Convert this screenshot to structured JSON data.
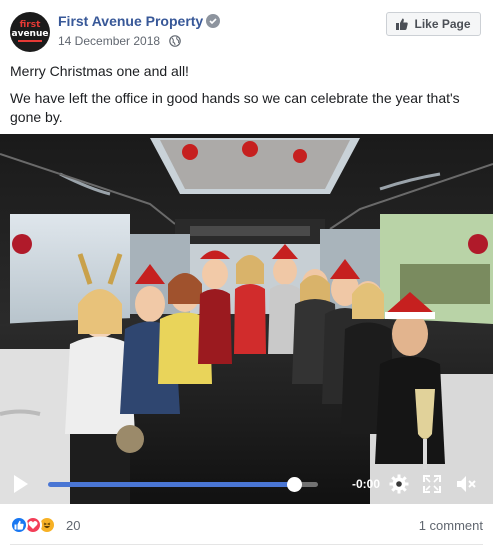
{
  "header": {
    "avatar_line1": "first",
    "avatar_line2": "avenue",
    "page_name": "First Avenue Property",
    "date": "14 December 2018",
    "like_page_label": "Like Page"
  },
  "post": {
    "paragraphs": [
      "Merry Christmas one and all!",
      "We have left the office in good hands so we can celebrate the year that's gone by."
    ]
  },
  "video": {
    "time_remaining": "-0:00",
    "progress_fraction": 0.91
  },
  "footer": {
    "reaction_count": "20",
    "comments_label": "1 comment",
    "reactions": [
      "like",
      "love",
      "haha"
    ]
  },
  "colors": {
    "link": "#385898",
    "like_blue": "#1877f2",
    "love_red": "#f33e58",
    "haha_yellow": "#f7b125",
    "progress_blue": "#4a76d4"
  }
}
